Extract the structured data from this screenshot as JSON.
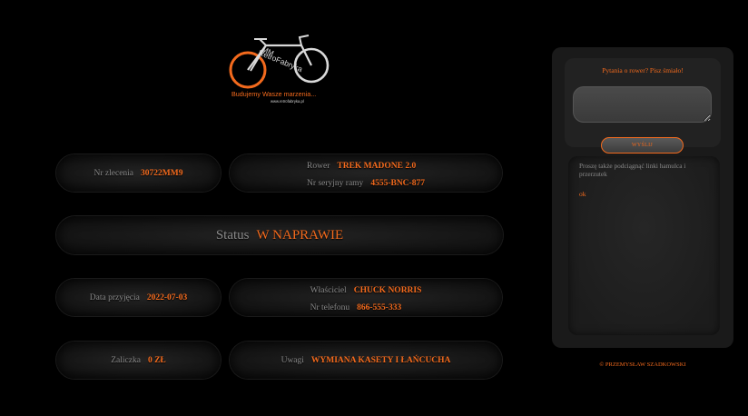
{
  "logo": {
    "monogram": "MM",
    "name": "RetroFabryka",
    "tagline": "Budujemy Wasze marzenia...",
    "url": "www.retrofabryka.pl",
    "accent": "#f36a1d"
  },
  "order": {
    "number_label": "Nr zlecenia",
    "number_value": "30722MM9",
    "bike_label": "Rower",
    "bike_value": "TREK MADONE 2.0",
    "serial_label": "Nr seryjny ramy",
    "serial_value": "4555-BNC-877",
    "status_label": "Status",
    "status_value": "W NAPRAWIE",
    "date_label": "Data przyjęcia",
    "date_value": "2022-07-03",
    "owner_label": "Właściciel",
    "owner_value": "CHUCK NORRIS",
    "phone_label": "Nr telefonu",
    "phone_value": "866-555-333",
    "deposit_label": "Zaliczka",
    "deposit_value": "0 ZŁ",
    "notes_label": "Uwagi",
    "notes_value": "WYMIANA KASETY I ŁAŃCUCHA"
  },
  "sidebar": {
    "question_title": "Pytania o rower? Pisz śmiało!",
    "question_placeholder": "",
    "send_label": "WYŚLIJ",
    "links_text": "Proszę także podciągnąć linki hamulca i przerzutek",
    "links_ok": "ok",
    "footer": "© PRZEMYSŁAW SZADKOWSKI"
  },
  "colors": {
    "accent": "#f36a1d",
    "label": "#8a8a8a",
    "background": "#000000"
  }
}
